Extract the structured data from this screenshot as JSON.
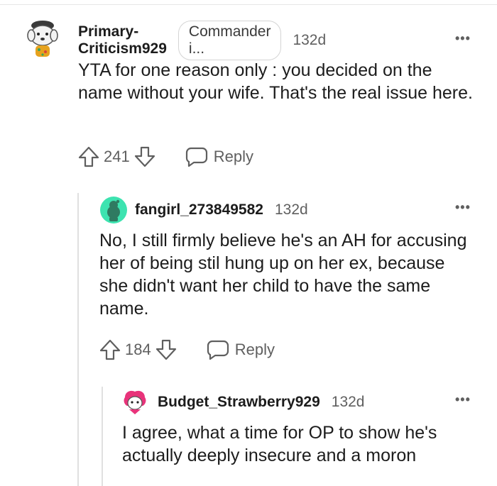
{
  "comments": [
    {
      "username": "Primary-Criticism929",
      "flair": "Commander i...",
      "time": "132d",
      "body": "YTA for one reason only : you decided on the name without your wife. That's the real issue here.",
      "votes": "241",
      "reply_label": "Reply"
    },
    {
      "username": "fangirl_273849582",
      "time": "132d",
      "body": "No, I still firmly believe he's an AH for accusing her of being stil hung up on her ex, because she didn't want her child to have the same name.",
      "votes": "184",
      "reply_label": "Reply"
    },
    {
      "username": "Budget_Strawberry929",
      "time": "132d",
      "body": "I agree, what a time for OP to show he's actually deeply insecure and a moron"
    }
  ],
  "more_glyph": "•••",
  "colors": {
    "accent_avatar_teal": "#3de3b0",
    "muted": "#5f5f5f",
    "avatar_pink": "#e8337a"
  }
}
